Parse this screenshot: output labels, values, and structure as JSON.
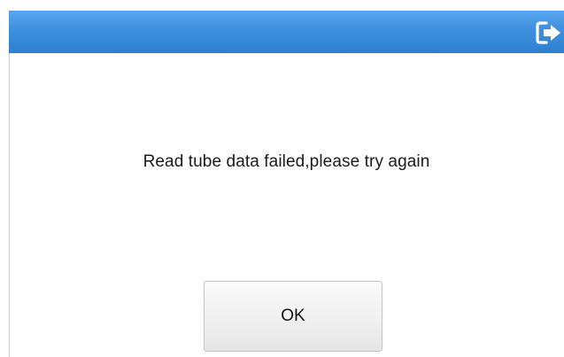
{
  "dialog": {
    "message": "Read tube data failed,please try again",
    "ok_label": "OK"
  },
  "titlebar": {
    "exit_icon": "exit-icon"
  },
  "colors": {
    "titlebar_top": "#5aa6ee",
    "titlebar_bottom": "#2f7fd2",
    "background": "#ffffff",
    "text": "#1a1a1a"
  }
}
